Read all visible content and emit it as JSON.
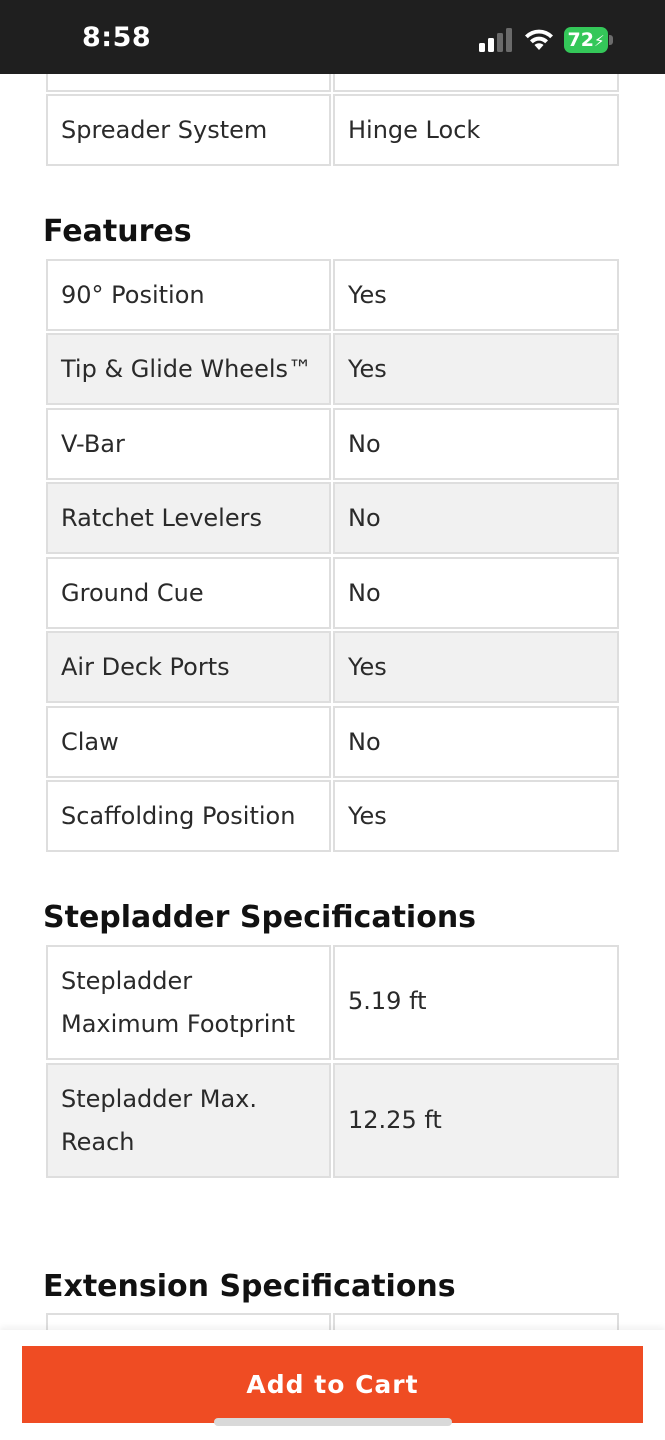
{
  "status_bar": {
    "time": "8:58",
    "battery_level": "72",
    "signal_bars_active": 2,
    "signal_bars_total": 4,
    "icons": [
      "cellular-signal-icon",
      "wifi-icon",
      "battery-charging-icon"
    ],
    "colors": {
      "background": "#1f1f1f",
      "battery": "#34c759"
    }
  },
  "general_specs": {
    "rows": [
      {
        "label": "Spreader System",
        "value": "Hinge Lock"
      }
    ]
  },
  "features": {
    "heading": "Features",
    "rows": [
      {
        "label": "90° Position",
        "value": "Yes"
      },
      {
        "label": "Tip & Glide Wheels™",
        "value": "Yes"
      },
      {
        "label": "V-Bar",
        "value": "No"
      },
      {
        "label": "Ratchet Levelers",
        "value": "No"
      },
      {
        "label": "Ground Cue",
        "value": "No"
      },
      {
        "label": "Air Deck Ports",
        "value": "Yes"
      },
      {
        "label": "Claw",
        "value": "No"
      },
      {
        "label": "Scaffolding Position",
        "value": "Yes"
      }
    ]
  },
  "stepladder_specs": {
    "heading": "Stepladder Specifications",
    "rows": [
      {
        "label_line1": "Stepladder",
        "label_line2": "Maximum Footprint",
        "value": "5.19 ft"
      },
      {
        "label_line1": "Stepladder Max.",
        "label_line2": "Reach",
        "value": "12.25 ft"
      }
    ]
  },
  "extension_specs": {
    "heading": "Extension Specifications"
  },
  "cart": {
    "button_label": "Add to Cart",
    "button_color": "#ef4c23"
  }
}
